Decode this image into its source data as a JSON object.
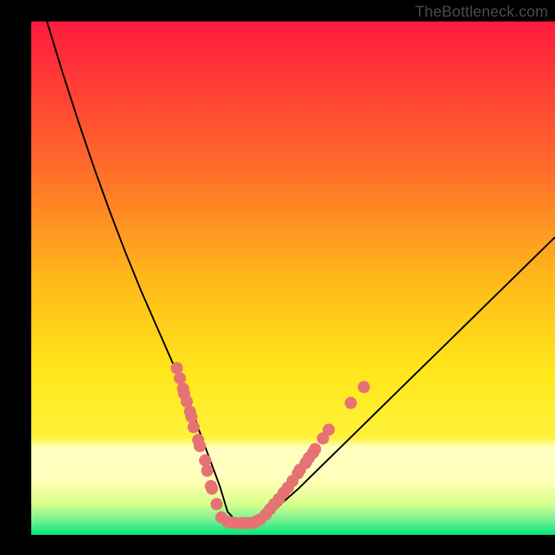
{
  "watermark": "TheBottleneck.com",
  "colors": {
    "bg_black": "#000000",
    "grad_top": "#ff1a3e",
    "grad_mid1": "#ff7a2a",
    "grad_mid2": "#ffd31a",
    "grad_mid3": "#fff23a",
    "grad_band_pale": "#ffffc0",
    "grad_bottom": "#00e676",
    "curve": "#000000",
    "dot_fill": "#e57373",
    "dot_stroke": "#c85a5a"
  },
  "chart_data": {
    "type": "line",
    "title": "",
    "xlabel": "",
    "ylabel": "",
    "xlim": [
      0,
      100
    ],
    "ylim": [
      0,
      100
    ],
    "series": [
      {
        "name": "bottleneck-curve",
        "x": [
          3,
          6,
          9,
          12,
          15,
          18,
          21,
          24,
          27,
          30,
          32,
          34,
          36,
          37.5,
          39.5,
          42,
          46,
          51,
          56,
          61,
          66,
          71,
          76,
          81,
          86,
          91,
          96,
          100
        ],
        "y": [
          100,
          90,
          80.5,
          71.5,
          63,
          55,
          47.5,
          40.5,
          33.5,
          26.5,
          20.5,
          15,
          9.5,
          4.5,
          2.3,
          2.3,
          4.5,
          9,
          14,
          19,
          24,
          29,
          34,
          39,
          44,
          49,
          54,
          58
        ]
      }
    ],
    "dot_clusters": [
      {
        "name": "left-cluster",
        "points": [
          [
            27.8,
            32.5
          ],
          [
            28.4,
            30.5
          ],
          [
            29.0,
            28.5
          ],
          [
            29.2,
            27.5
          ],
          [
            29.7,
            26.0
          ],
          [
            30.3,
            24.0
          ],
          [
            30.6,
            23.0
          ],
          [
            31.0,
            21.0
          ],
          [
            31.9,
            18.5
          ],
          [
            32.2,
            17.3
          ],
          [
            33.2,
            14.5
          ],
          [
            33.6,
            12.5
          ],
          [
            34.3,
            9.5
          ],
          [
            34.5,
            9.0
          ],
          [
            35.4,
            6.0
          ]
        ]
      },
      {
        "name": "bottom-cluster",
        "points": [
          [
            36.3,
            3.4
          ],
          [
            37.4,
            2.6
          ],
          [
            38.2,
            2.4
          ],
          [
            39.1,
            2.3
          ],
          [
            40.0,
            2.3
          ],
          [
            40.9,
            2.3
          ],
          [
            41.8,
            2.3
          ],
          [
            42.5,
            2.4
          ],
          [
            43.1,
            2.7
          ],
          [
            43.7,
            3.0
          ]
        ]
      },
      {
        "name": "right-cluster",
        "points": [
          [
            44.8,
            4.0
          ],
          [
            45.6,
            5.0
          ],
          [
            46.4,
            6.0
          ],
          [
            47.3,
            7.0
          ],
          [
            48.2,
            8.2
          ],
          [
            49.0,
            9.2
          ],
          [
            49.9,
            10.5
          ],
          [
            50.9,
            12.0
          ],
          [
            51.3,
            12.7
          ],
          [
            52.4,
            14.0
          ],
          [
            53.0,
            15.0
          ],
          [
            53.8,
            16.0
          ],
          [
            54.2,
            16.7
          ],
          [
            55.7,
            18.8
          ],
          [
            56.8,
            20.5
          ],
          [
            61.0,
            25.7
          ],
          [
            63.5,
            28.8
          ]
        ]
      }
    ]
  }
}
